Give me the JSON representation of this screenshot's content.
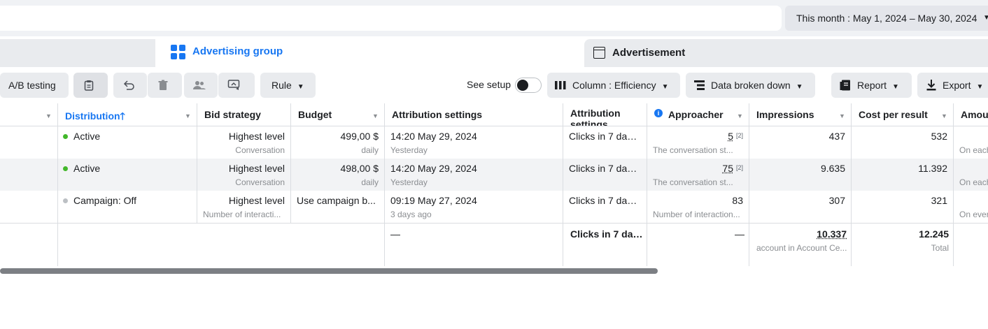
{
  "header": {
    "date_range": "This month : May 1, 2024 – May 30, 2024"
  },
  "tabs": [
    {
      "label": "Advertising group",
      "active": true,
      "icon": "grid-icon"
    },
    {
      "label": "Advertisement",
      "active": false,
      "icon": "window-icon"
    }
  ],
  "toolbar": {
    "ab_testing": "A/B testing",
    "rule": "Rule",
    "see_setup": "See setup",
    "column": "Column : Efficiency",
    "breakdown": "Data broken down",
    "report": "Report",
    "export": "Export"
  },
  "columns": {
    "distribution": "Distribution",
    "bid_strategy": "Bid strategy",
    "budget": "Budget",
    "attribution": "Attribution settings",
    "attribution2": "Attribution settings",
    "approacher": "Approacher",
    "impressions": "Impressions",
    "cost_per_result": "Cost per result",
    "amount": "Amour"
  },
  "rows": [
    {
      "status": "Active",
      "status_color": "#42b72a",
      "bid": "Highest level",
      "bid_sub": "Conversation",
      "budget": "499,00 $",
      "budget_sub": "daily",
      "attr": "14:20 May 29, 2024",
      "attr_sub": "Yesterday",
      "attr2": "Clicks in 7 days...",
      "approacher": "5",
      "approacher_sup": "[2]",
      "approacher_sub": "The conversation st...",
      "impressions": "437",
      "cost": "532",
      "amount_sub": "On each"
    },
    {
      "status": "Active",
      "status_color": "#42b72a",
      "bid": "Highest level",
      "bid_sub": "Conversation",
      "budget": "498,00 $",
      "budget_sub": "daily",
      "attr": "14:20 May 29, 2024",
      "attr_sub": "Yesterday",
      "attr2": "Clicks in 7 days...",
      "approacher": "75",
      "approacher_sup": "[2]",
      "approacher_sub": "The conversation st...",
      "impressions": "9.635",
      "cost": "11.392",
      "amount_sub": "On each"
    },
    {
      "status": "Campaign: Off",
      "status_color": "#bcc0c4",
      "bid": "Highest level",
      "bid_sub": "Number of interacti...",
      "budget": "Use campaign b...",
      "budget_sub": "",
      "attr": "09:19 May 27, 2024",
      "attr_sub": "3 days ago",
      "attr2": "Clicks in 7 days...",
      "approacher": "83",
      "approacher_sup": "",
      "approacher_sub": "Number of interaction...",
      "impressions": "307",
      "cost": "321",
      "amount_sub": "On ever"
    }
  ],
  "totals": {
    "attr": "—",
    "attr2": "Clicks in 7 day...",
    "approacher": "—",
    "impressions": "10.337",
    "impressions_sub": "account in Account Ce...",
    "cost": "12.245",
    "cost_sub": "Total"
  }
}
